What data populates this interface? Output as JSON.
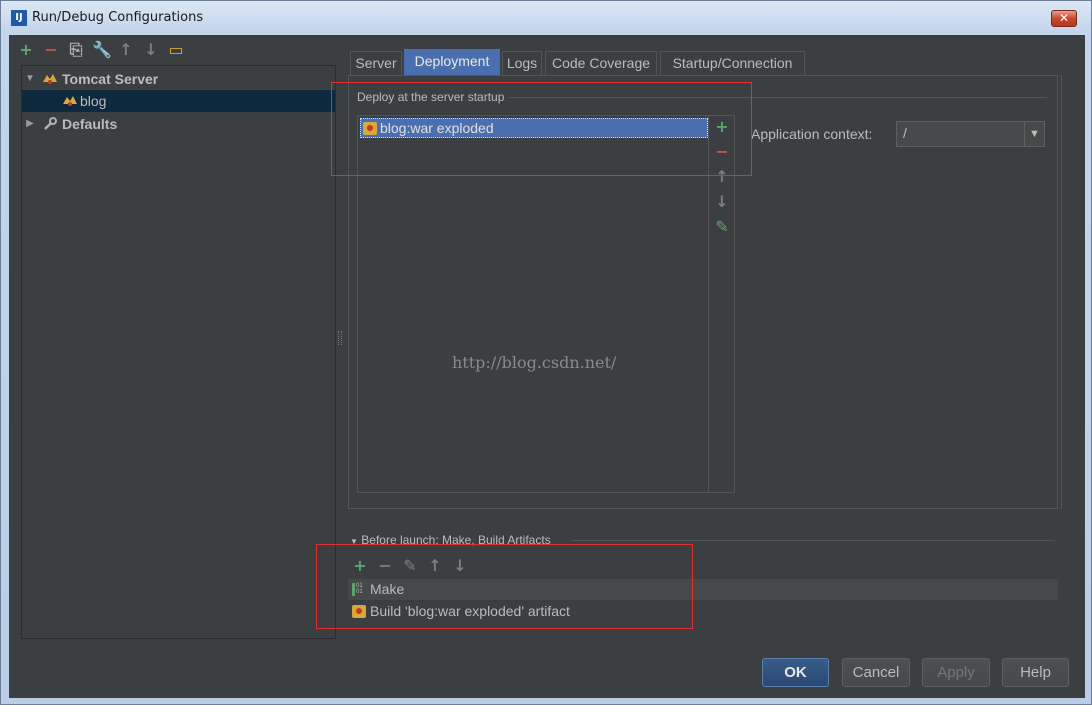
{
  "window": {
    "title": "Run/Debug Configurations",
    "icon": "intellij-icon",
    "close_glyph": "✕"
  },
  "left_toolbar": [
    {
      "name": "add-icon",
      "glyph": "+",
      "color": "#59a869"
    },
    {
      "name": "remove-icon",
      "glyph": "−",
      "color": "#c75450"
    },
    {
      "name": "copy-icon",
      "glyph": "⎘",
      "color": "#afb1b3"
    },
    {
      "name": "wrench-icon",
      "glyph": "🔧",
      "color": "#afb1b3"
    },
    {
      "name": "move-up-icon",
      "glyph": "↑",
      "color": "#7c7f81"
    },
    {
      "name": "move-down-icon",
      "glyph": "↓",
      "color": "#7c7f81"
    },
    {
      "name": "folder-icon",
      "glyph": "▭",
      "color": "#d8a93a"
    }
  ],
  "tree": {
    "items": [
      {
        "label": "Tomcat Server",
        "arrow": "▼",
        "icon": "tomcat-icon",
        "bold": true,
        "level": 0
      },
      {
        "label": "blog",
        "arrow": "",
        "icon": "tomcat-icon",
        "bold": false,
        "level": 1,
        "selected": true
      },
      {
        "label": "Defaults",
        "arrow": "▶",
        "icon": "wrench-icon",
        "bold": true,
        "level": 0
      }
    ]
  },
  "tabs": [
    "Server",
    "Deployment",
    "Logs",
    "Code Coverage",
    "Startup/Connection"
  ],
  "active_tab": "Deployment",
  "deployment": {
    "group_label": "Deploy at the server startup",
    "items": [
      "blog:war exploded"
    ],
    "side_buttons": [
      {
        "name": "add-icon",
        "glyph": "+",
        "color": "#59a869"
      },
      {
        "name": "remove-icon",
        "glyph": "−",
        "color": "#c75450"
      },
      {
        "name": "move-up-icon",
        "glyph": "↑",
        "color": "#7c7f81"
      },
      {
        "name": "move-down-icon",
        "glyph": "↓",
        "color": "#7c7f81"
      },
      {
        "name": "edit-icon",
        "glyph": "✎",
        "color": "#59a869"
      }
    ],
    "context_label": "Application context:",
    "context_value": "/",
    "context_arrow": "▼"
  },
  "watermark": "http://blog.csdn.net/",
  "before_launch": {
    "title": "Before launch: Make, Build Artifacts",
    "arrow": "▼",
    "toolbar": [
      {
        "name": "add-icon",
        "glyph": "+",
        "color": "#59a869"
      },
      {
        "name": "remove-icon",
        "glyph": "−",
        "color": "#7c7f81"
      },
      {
        "name": "edit-icon",
        "glyph": "✎",
        "color": "#7c7f81"
      },
      {
        "name": "move-up-icon",
        "glyph": "↑",
        "color": "#7c7f81"
      },
      {
        "name": "move-down-icon",
        "glyph": "↓",
        "color": "#7c7f81"
      }
    ],
    "tasks": [
      "Make",
      "Build 'blog:war exploded' artifact"
    ]
  },
  "buttons": {
    "ok": "OK",
    "cancel": "Cancel",
    "apply": "Apply",
    "help": "Help"
  },
  "colors": {
    "accent": "#4b6eaf",
    "background": "#3c3f41",
    "highlight_box": "#e03030"
  }
}
